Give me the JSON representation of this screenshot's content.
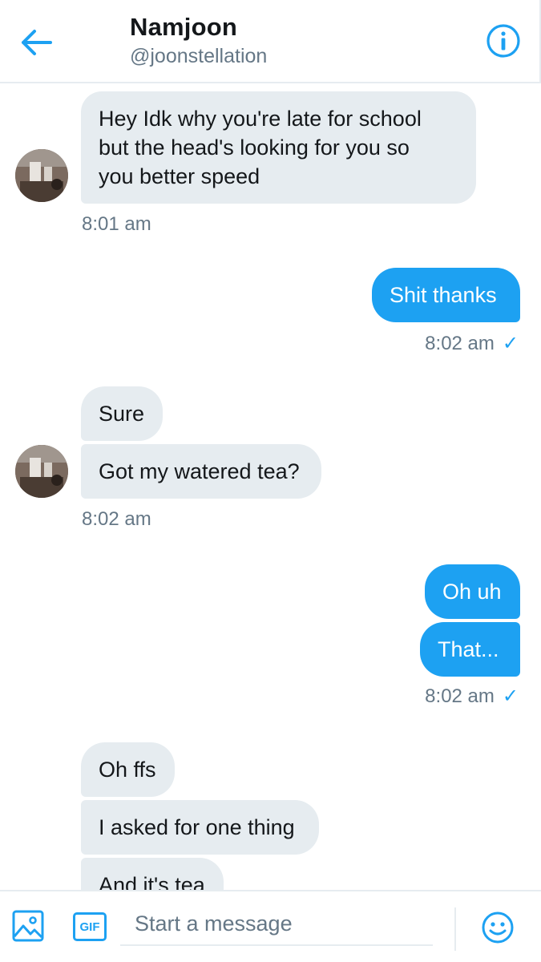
{
  "header": {
    "name": "Namjoon",
    "handle": "@joonstellation",
    "back_icon": "back-arrow-icon",
    "info_icon": "info-icon"
  },
  "messages": {
    "m1": {
      "text_lines": [
        "Hey Idk why you're late for school",
        "but the head's looking for you so",
        "you better speed"
      ],
      "time": "8:01 am"
    },
    "m2": {
      "text": "Shit thanks",
      "time": "8:02 am"
    },
    "m3": {
      "text": "Sure"
    },
    "m4": {
      "text": "Got my watered tea?",
      "time": "8:02 am"
    },
    "m5": {
      "text": "Oh uh"
    },
    "m6": {
      "text": "That...",
      "time": "8:02 am"
    },
    "m7": {
      "text": "Oh ffs"
    },
    "m8": {
      "text": "I asked for one thing"
    },
    "m9": {
      "text": "And it's tea"
    }
  },
  "composer": {
    "placeholder": "Start a message",
    "gif_label": "GIF",
    "image_icon": "image-icon",
    "emoji_icon": "emoji-icon"
  },
  "colors": {
    "accent": "#1da1f2",
    "received_bubble": "#e6ecf0",
    "muted_text": "#657786"
  }
}
